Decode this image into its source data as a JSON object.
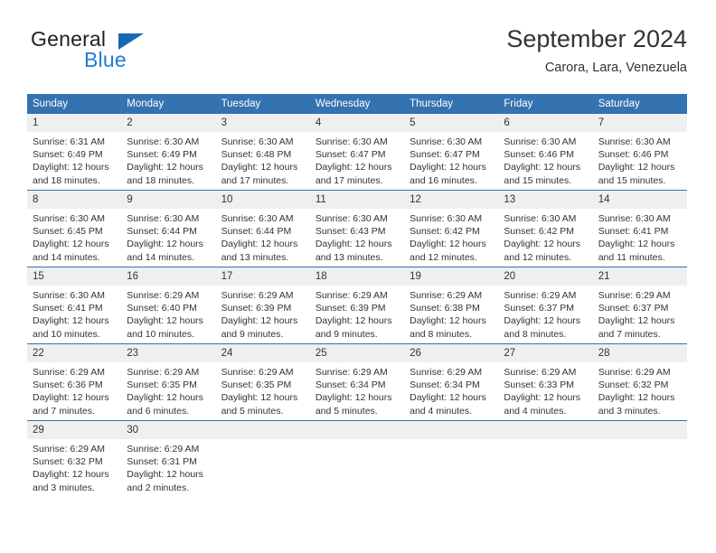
{
  "brand": {
    "name_part1": "General",
    "name_part2": "Blue",
    "logo_icon": "triangle-logo-icon"
  },
  "header": {
    "month_title": "September 2024",
    "location": "Carora, Lara, Venezuela"
  },
  "calendar": {
    "weekday_headers": [
      "Sunday",
      "Monday",
      "Tuesday",
      "Wednesday",
      "Thursday",
      "Friday",
      "Saturday"
    ],
    "colors": {
      "header_blue": "#3572b0",
      "daynum_band": "#efefef",
      "text": "#333333",
      "brand_blue": "#1c7fd3"
    },
    "weeks": [
      [
        {
          "day": "1",
          "sunrise": "Sunrise: 6:31 AM",
          "sunset": "Sunset: 6:49 PM",
          "daylight_line1": "Daylight: 12 hours",
          "daylight_line2": "and 18 minutes."
        },
        {
          "day": "2",
          "sunrise": "Sunrise: 6:30 AM",
          "sunset": "Sunset: 6:49 PM",
          "daylight_line1": "Daylight: 12 hours",
          "daylight_line2": "and 18 minutes."
        },
        {
          "day": "3",
          "sunrise": "Sunrise: 6:30 AM",
          "sunset": "Sunset: 6:48 PM",
          "daylight_line1": "Daylight: 12 hours",
          "daylight_line2": "and 17 minutes."
        },
        {
          "day": "4",
          "sunrise": "Sunrise: 6:30 AM",
          "sunset": "Sunset: 6:47 PM",
          "daylight_line1": "Daylight: 12 hours",
          "daylight_line2": "and 17 minutes."
        },
        {
          "day": "5",
          "sunrise": "Sunrise: 6:30 AM",
          "sunset": "Sunset: 6:47 PM",
          "daylight_line1": "Daylight: 12 hours",
          "daylight_line2": "and 16 minutes."
        },
        {
          "day": "6",
          "sunrise": "Sunrise: 6:30 AM",
          "sunset": "Sunset: 6:46 PM",
          "daylight_line1": "Daylight: 12 hours",
          "daylight_line2": "and 15 minutes."
        },
        {
          "day": "7",
          "sunrise": "Sunrise: 6:30 AM",
          "sunset": "Sunset: 6:46 PM",
          "daylight_line1": "Daylight: 12 hours",
          "daylight_line2": "and 15 minutes."
        }
      ],
      [
        {
          "day": "8",
          "sunrise": "Sunrise: 6:30 AM",
          "sunset": "Sunset: 6:45 PM",
          "daylight_line1": "Daylight: 12 hours",
          "daylight_line2": "and 14 minutes."
        },
        {
          "day": "9",
          "sunrise": "Sunrise: 6:30 AM",
          "sunset": "Sunset: 6:44 PM",
          "daylight_line1": "Daylight: 12 hours",
          "daylight_line2": "and 14 minutes."
        },
        {
          "day": "10",
          "sunrise": "Sunrise: 6:30 AM",
          "sunset": "Sunset: 6:44 PM",
          "daylight_line1": "Daylight: 12 hours",
          "daylight_line2": "and 13 minutes."
        },
        {
          "day": "11",
          "sunrise": "Sunrise: 6:30 AM",
          "sunset": "Sunset: 6:43 PM",
          "daylight_line1": "Daylight: 12 hours",
          "daylight_line2": "and 13 minutes."
        },
        {
          "day": "12",
          "sunrise": "Sunrise: 6:30 AM",
          "sunset": "Sunset: 6:42 PM",
          "daylight_line1": "Daylight: 12 hours",
          "daylight_line2": "and 12 minutes."
        },
        {
          "day": "13",
          "sunrise": "Sunrise: 6:30 AM",
          "sunset": "Sunset: 6:42 PM",
          "daylight_line1": "Daylight: 12 hours",
          "daylight_line2": "and 12 minutes."
        },
        {
          "day": "14",
          "sunrise": "Sunrise: 6:30 AM",
          "sunset": "Sunset: 6:41 PM",
          "daylight_line1": "Daylight: 12 hours",
          "daylight_line2": "and 11 minutes."
        }
      ],
      [
        {
          "day": "15",
          "sunrise": "Sunrise: 6:30 AM",
          "sunset": "Sunset: 6:41 PM",
          "daylight_line1": "Daylight: 12 hours",
          "daylight_line2": "and 10 minutes."
        },
        {
          "day": "16",
          "sunrise": "Sunrise: 6:29 AM",
          "sunset": "Sunset: 6:40 PM",
          "daylight_line1": "Daylight: 12 hours",
          "daylight_line2": "and 10 minutes."
        },
        {
          "day": "17",
          "sunrise": "Sunrise: 6:29 AM",
          "sunset": "Sunset: 6:39 PM",
          "daylight_line1": "Daylight: 12 hours",
          "daylight_line2": "and 9 minutes."
        },
        {
          "day": "18",
          "sunrise": "Sunrise: 6:29 AM",
          "sunset": "Sunset: 6:39 PM",
          "daylight_line1": "Daylight: 12 hours",
          "daylight_line2": "and 9 minutes."
        },
        {
          "day": "19",
          "sunrise": "Sunrise: 6:29 AM",
          "sunset": "Sunset: 6:38 PM",
          "daylight_line1": "Daylight: 12 hours",
          "daylight_line2": "and 8 minutes."
        },
        {
          "day": "20",
          "sunrise": "Sunrise: 6:29 AM",
          "sunset": "Sunset: 6:37 PM",
          "daylight_line1": "Daylight: 12 hours",
          "daylight_line2": "and 8 minutes."
        },
        {
          "day": "21",
          "sunrise": "Sunrise: 6:29 AM",
          "sunset": "Sunset: 6:37 PM",
          "daylight_line1": "Daylight: 12 hours",
          "daylight_line2": "and 7 minutes."
        }
      ],
      [
        {
          "day": "22",
          "sunrise": "Sunrise: 6:29 AM",
          "sunset": "Sunset: 6:36 PM",
          "daylight_line1": "Daylight: 12 hours",
          "daylight_line2": "and 7 minutes."
        },
        {
          "day": "23",
          "sunrise": "Sunrise: 6:29 AM",
          "sunset": "Sunset: 6:35 PM",
          "daylight_line1": "Daylight: 12 hours",
          "daylight_line2": "and 6 minutes."
        },
        {
          "day": "24",
          "sunrise": "Sunrise: 6:29 AM",
          "sunset": "Sunset: 6:35 PM",
          "daylight_line1": "Daylight: 12 hours",
          "daylight_line2": "and 5 minutes."
        },
        {
          "day": "25",
          "sunrise": "Sunrise: 6:29 AM",
          "sunset": "Sunset: 6:34 PM",
          "daylight_line1": "Daylight: 12 hours",
          "daylight_line2": "and 5 minutes."
        },
        {
          "day": "26",
          "sunrise": "Sunrise: 6:29 AM",
          "sunset": "Sunset: 6:34 PM",
          "daylight_line1": "Daylight: 12 hours",
          "daylight_line2": "and 4 minutes."
        },
        {
          "day": "27",
          "sunrise": "Sunrise: 6:29 AM",
          "sunset": "Sunset: 6:33 PM",
          "daylight_line1": "Daylight: 12 hours",
          "daylight_line2": "and 4 minutes."
        },
        {
          "day": "28",
          "sunrise": "Sunrise: 6:29 AM",
          "sunset": "Sunset: 6:32 PM",
          "daylight_line1": "Daylight: 12 hours",
          "daylight_line2": "and 3 minutes."
        }
      ],
      [
        {
          "day": "29",
          "sunrise": "Sunrise: 6:29 AM",
          "sunset": "Sunset: 6:32 PM",
          "daylight_line1": "Daylight: 12 hours",
          "daylight_line2": "and 3 minutes."
        },
        {
          "day": "30",
          "sunrise": "Sunrise: 6:29 AM",
          "sunset": "Sunset: 6:31 PM",
          "daylight_line1": "Daylight: 12 hours",
          "daylight_line2": "and 2 minutes."
        },
        {
          "day": "",
          "sunrise": "",
          "sunset": "",
          "daylight_line1": "",
          "daylight_line2": "",
          "empty": true
        },
        {
          "day": "",
          "sunrise": "",
          "sunset": "",
          "daylight_line1": "",
          "daylight_line2": "",
          "empty": true
        },
        {
          "day": "",
          "sunrise": "",
          "sunset": "",
          "daylight_line1": "",
          "daylight_line2": "",
          "empty": true
        },
        {
          "day": "",
          "sunrise": "",
          "sunset": "",
          "daylight_line1": "",
          "daylight_line2": "",
          "empty": true
        },
        {
          "day": "",
          "sunrise": "",
          "sunset": "",
          "daylight_line1": "",
          "daylight_line2": "",
          "empty": true
        }
      ]
    ]
  }
}
